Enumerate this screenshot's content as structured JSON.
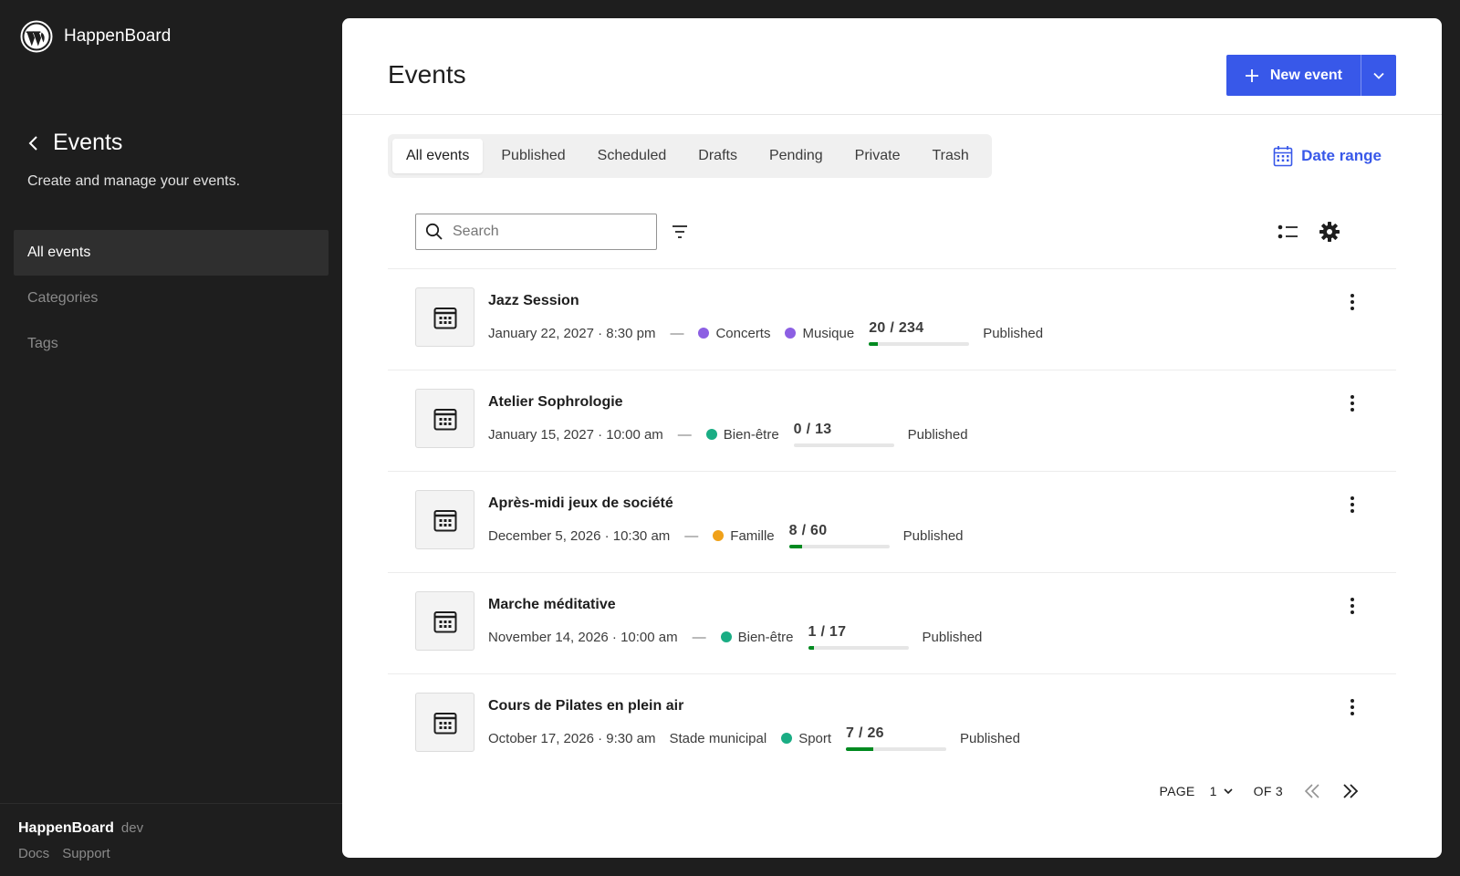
{
  "app": {
    "name": "HappenBoard"
  },
  "sidebar": {
    "title": "Events",
    "description": "Create and manage your events.",
    "items": [
      {
        "label": "All events",
        "active": true
      },
      {
        "label": "Categories",
        "active": false
      },
      {
        "label": "Tags",
        "active": false
      }
    ],
    "footer": {
      "name": "HappenBoard",
      "env": "dev",
      "links": [
        "Docs",
        "Support"
      ]
    }
  },
  "header": {
    "title": "Events",
    "new_button": "New event"
  },
  "tabs": [
    "All events",
    "Published",
    "Scheduled",
    "Drafts",
    "Pending",
    "Private",
    "Trash"
  ],
  "date_range": "Date range",
  "search": {
    "placeholder": "Search",
    "value": ""
  },
  "colors": {
    "accent": "#3858e9",
    "progress": "#008a20"
  },
  "events": [
    {
      "title": "Jazz Session",
      "date": "January 22, 2027 · 8:30 pm",
      "separator": "—",
      "venue": "",
      "categories": [
        {
          "name": "Concerts",
          "color": "#8c5fe3"
        },
        {
          "name": "Musique",
          "color": "#8c5fe3"
        }
      ],
      "capacity": "20 / 234",
      "fill": 0.085,
      "status": "Published"
    },
    {
      "title": "Atelier Sophrologie",
      "date": "January 15, 2027 · 10:00 am",
      "separator": "—",
      "venue": "",
      "categories": [
        {
          "name": "Bien-être",
          "color": "#1aad84"
        }
      ],
      "capacity": "0 / 13",
      "fill": 0,
      "status": "Published"
    },
    {
      "title": "Après-midi jeux de société",
      "date": "December 5, 2026 · 10:30 am",
      "separator": "—",
      "venue": "",
      "categories": [
        {
          "name": "Famille",
          "color": "#f0a119"
        }
      ],
      "capacity": "8 / 60",
      "fill": 0.133,
      "status": "Published"
    },
    {
      "title": "Marche méditative",
      "date": "November 14, 2026 · 10:00 am",
      "separator": "—",
      "venue": "",
      "categories": [
        {
          "name": "Bien-être",
          "color": "#1aad84"
        }
      ],
      "capacity": "1 / 17",
      "fill": 0.059,
      "status": "Published"
    },
    {
      "title": "Cours de Pilates en plein air",
      "date": "October 17, 2026 · 9:30 am",
      "separator": "",
      "venue": "Stade municipal",
      "categories": [
        {
          "name": "Sport",
          "color": "#1aad84"
        }
      ],
      "capacity": "7 / 26",
      "fill": 0.269,
      "status": "Published"
    }
  ],
  "pagination": {
    "label": "PAGE",
    "current": "1",
    "of_label": "OF 3"
  }
}
